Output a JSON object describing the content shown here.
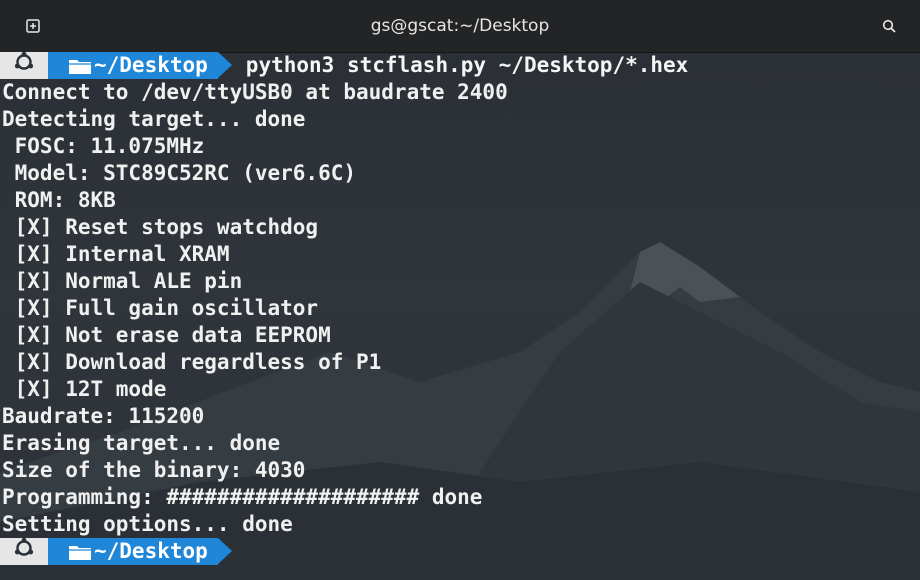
{
  "window": {
    "title": "gs@gscat:~/Desktop",
    "new_tab_icon": "new-tab-icon",
    "search_icon": "search-icon"
  },
  "colors": {
    "prompt_os_bg": "#e6e6e6",
    "prompt_dir_bg": "#1f86d8",
    "text": "#f0f0f0",
    "background": "#2b3137"
  },
  "prompt": {
    "os_icon": "ubuntu-icon",
    "folder_icon": "folder-icon",
    "directory": "~/Desktop",
    "command": "python3 stcflash.py ~/Desktop/*.hex"
  },
  "output": [
    "Connect to /dev/ttyUSB0 at baudrate 2400",
    "Detecting target... done",
    " FOSC: 11.075MHz",
    " Model: STC89C52RC (ver6.6C)",
    " ROM: 8KB",
    " [X] Reset stops watchdog",
    " [X] Internal XRAM",
    " [X] Normal ALE pin",
    " [X] Full gain oscillator",
    " [X] Not erase data EEPROM",
    " [X] Download regardless of P1",
    " [X] 12T mode",
    "Baudrate: 115200",
    "Erasing target... done",
    "Size of the binary: 4030",
    "Programming: #################### done",
    "Setting options... done"
  ],
  "prompt2": {
    "directory": "~/Desktop"
  }
}
